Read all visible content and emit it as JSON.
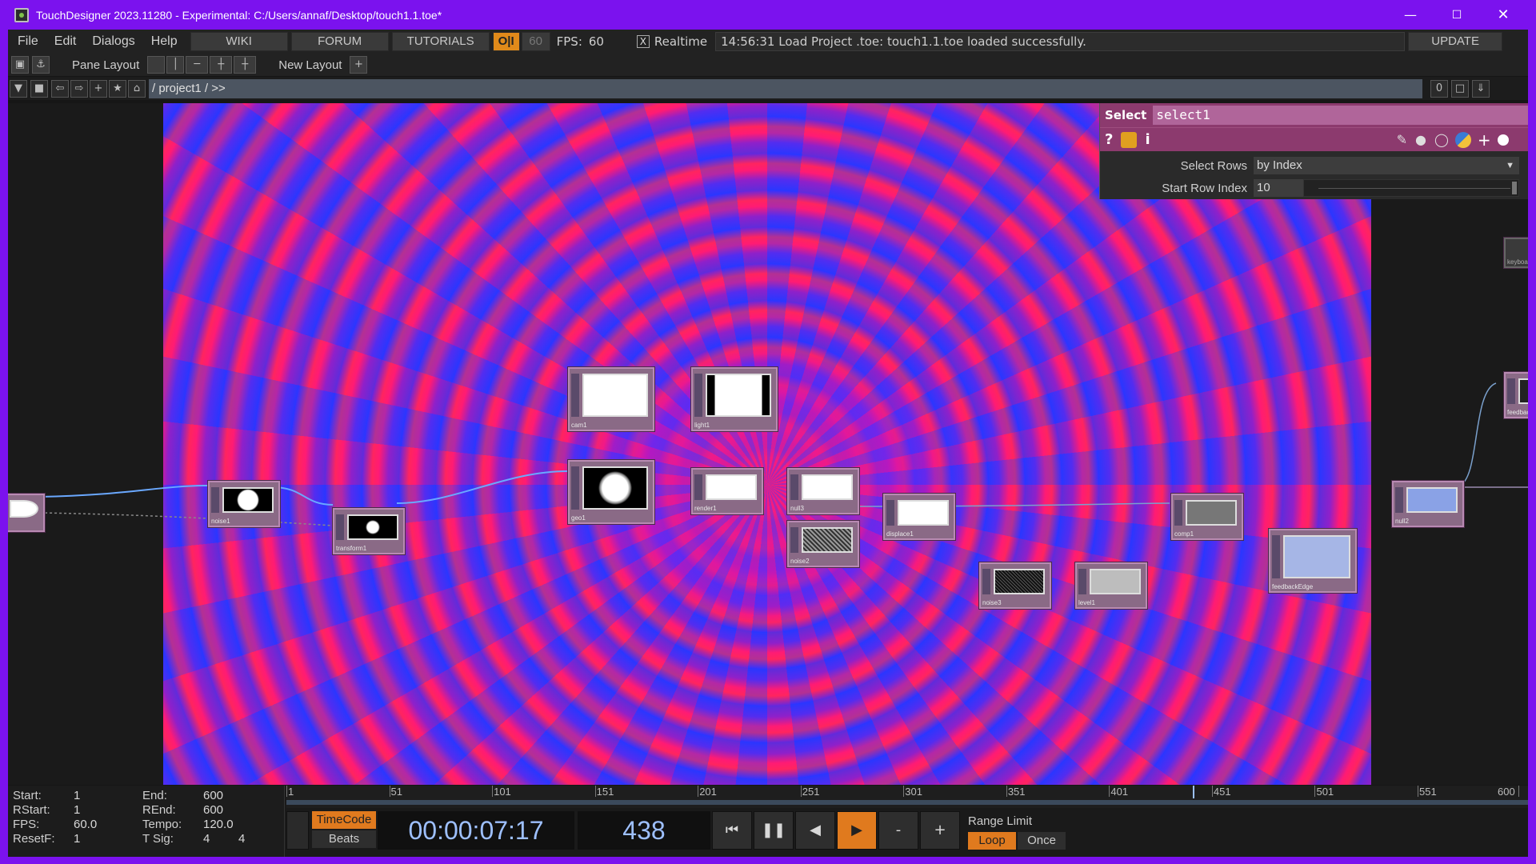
{
  "window": {
    "title": "TouchDesigner 2023.11280 - Experimental: C:/Users/annaf/Desktop/touch1.1.toe*"
  },
  "menu": [
    "File",
    "Edit",
    "Dialogs",
    "Help"
  ],
  "links": [
    "WIKI",
    "FORUM",
    "TUTORIALS"
  ],
  "perf": {
    "oi": "O|I",
    "fps_cap": "60",
    "fps_label": "FPS:",
    "fps_value": "60",
    "realtime_check": "X",
    "realtime_label": "Realtime"
  },
  "status": "14:56:31 Load Project .toe: touch1.1.toe loaded successfully.",
  "update_label": "UPDATE",
  "pane_layout_label": "Pane Layout",
  "new_layout_label": "New Layout",
  "path": "/ project1 / >>",
  "path_count": "0",
  "param": {
    "op_type": "Select",
    "op_name": "select1",
    "rows": [
      {
        "label": "Select Rows",
        "value": "by Index"
      },
      {
        "label": "Start Row Index",
        "value": "10"
      }
    ]
  },
  "nodes": [
    {
      "name": "noise1"
    },
    {
      "name": "transform1"
    },
    {
      "name": "cam1"
    },
    {
      "name": "light1"
    },
    {
      "name": "geo1"
    },
    {
      "name": "render1"
    },
    {
      "name": "null3"
    },
    {
      "name": "noise2"
    },
    {
      "name": "displace1"
    },
    {
      "name": "noise3"
    },
    {
      "name": "level1"
    },
    {
      "name": "comp1"
    },
    {
      "name": "feedbackEdge"
    },
    {
      "name": "null2"
    },
    {
      "name": "feedbac"
    },
    {
      "name": "keyboar"
    }
  ],
  "timeline": {
    "start_label": "Start:",
    "start": "1",
    "rstart_label": "RStart:",
    "rstart": "1",
    "fps_label": "FPS:",
    "fps": "60.0",
    "resetf_label": "ResetF:",
    "resetf": "1",
    "end_label": "End:",
    "end": "600",
    "rend_label": "REnd:",
    "rend": "600",
    "tempo_label": "Tempo:",
    "tempo": "120.0",
    "tsig_label": "T Sig:",
    "tsig_a": "4",
    "tsig_b": "4",
    "ticks": [
      "1",
      "51",
      "101",
      "151",
      "201",
      "251",
      "301",
      "351",
      "401",
      "451",
      "501",
      "551",
      "600"
    ],
    "timecode_label": "TimeCode",
    "beats_label": "Beats",
    "timecode": "00:00:07:17",
    "frame": "438",
    "range_limit_label": "Range Limit",
    "loop_label": "Loop",
    "once_label": "Once"
  },
  "colors": {
    "accent": "#7b12ee",
    "node": "#8a6a86",
    "param_header": "#8c3a6e",
    "play": "#e07a1e"
  }
}
